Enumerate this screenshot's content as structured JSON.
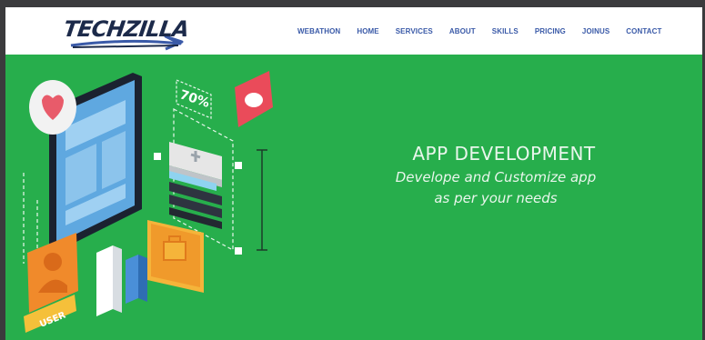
{
  "brand": {
    "logo_text": "TECHZILLA"
  },
  "nav": {
    "items": [
      {
        "label": "WEBATHON"
      },
      {
        "label": "HOME"
      },
      {
        "label": "SERVICES"
      },
      {
        "label": "ABOUT"
      },
      {
        "label": "SKILLS"
      },
      {
        "label": "PRICING"
      },
      {
        "label": "JOINUS"
      },
      {
        "label": "CONTACT"
      }
    ]
  },
  "hero": {
    "title": "APP DEVELOPMENT",
    "subtitle_line1": "Develope and Customize app",
    "subtitle_line2": "as per your needs",
    "percent_badge": "70%",
    "user_badge": "USER",
    "background_color": "#27ae4c"
  }
}
